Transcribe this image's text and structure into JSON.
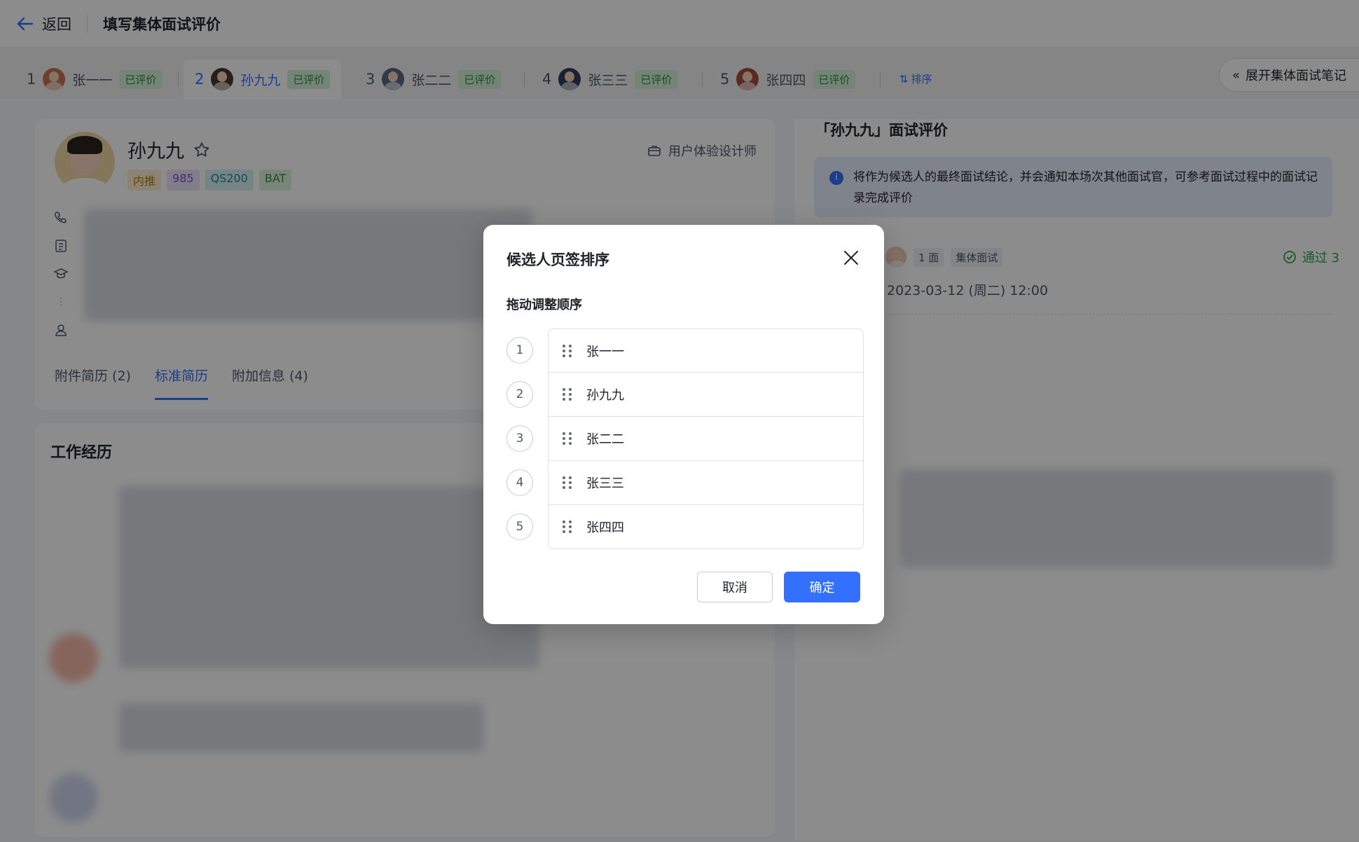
{
  "header": {
    "back_label": "返回",
    "title": "填写集体面试评价"
  },
  "tabs": [
    {
      "num": "1",
      "name": "张一一",
      "status": "已评价"
    },
    {
      "num": "2",
      "name": "孙九九",
      "status": "已评价"
    },
    {
      "num": "3",
      "name": "张二二",
      "status": "已评价"
    },
    {
      "num": "4",
      "name": "张三三",
      "status": "已评价"
    },
    {
      "num": "5",
      "name": "张四四",
      "status": "已评价"
    }
  ],
  "sort_label": "排序",
  "expand_notes_label": "展开集体面试笔记",
  "candidate": {
    "name": "孙九九",
    "tags": [
      "内推",
      "985",
      "QS200",
      "BAT"
    ],
    "job": "用户体验设计师"
  },
  "resume_tabs": [
    "附件简历 (2)",
    "标准简历",
    "附加信息 (4)"
  ],
  "work_title": "工作经历",
  "evaluation": {
    "title": "「孙九九」面试评价",
    "info": "将作为候选人的最终面试结论，并会通知本场次其他面试官，可参考面试过程中的面试记录完成评价",
    "round": "1 面",
    "type": "集体面试",
    "result": "通过 3",
    "time": "2023-03-12 (周二) 12:00"
  },
  "modal": {
    "title": "候选人页签排序",
    "subtitle": "拖动调整顺序",
    "items": [
      {
        "num": "1",
        "name": "张一一"
      },
      {
        "num": "2",
        "name": "孙九九"
      },
      {
        "num": "3",
        "name": "张二二"
      },
      {
        "num": "4",
        "name": "张三三"
      },
      {
        "num": "5",
        "name": "张四四"
      }
    ],
    "cancel_label": "取消",
    "ok_label": "确定"
  }
}
